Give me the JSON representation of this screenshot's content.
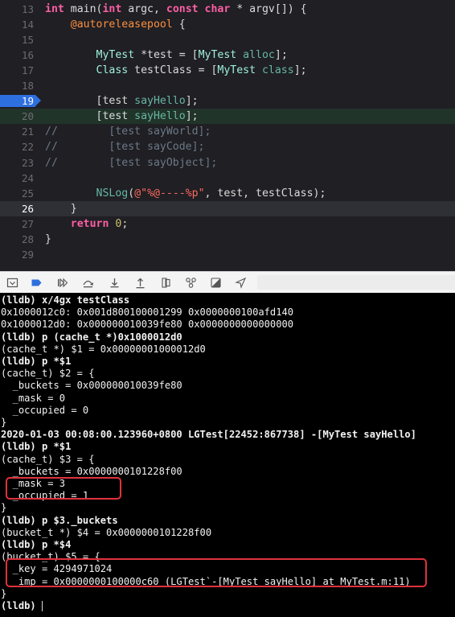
{
  "editor": {
    "lines": [
      {
        "num": "13",
        "tokens": [
          [
            "kw",
            "int"
          ],
          [
            "plain",
            " main("
          ],
          [
            "kw",
            "int"
          ],
          [
            "plain",
            " argc, "
          ],
          [
            "kw",
            "const"
          ],
          [
            "plain",
            " "
          ],
          [
            "kw",
            "char"
          ],
          [
            "plain",
            " * argv[]) {"
          ]
        ]
      },
      {
        "num": "14",
        "tokens": [
          [
            "plain",
            "    "
          ],
          [
            "macro",
            "@autoreleasepool"
          ],
          [
            "plain",
            " {"
          ]
        ]
      },
      {
        "num": "15",
        "tokens": []
      },
      {
        "num": "16",
        "tokens": [
          [
            "plain",
            "        "
          ],
          [
            "clsname",
            "MyTest"
          ],
          [
            "plain",
            " *test = ["
          ],
          [
            "clsname",
            "MyTest"
          ],
          [
            "plain",
            " "
          ],
          [
            "ex",
            "alloc"
          ],
          [
            "plain",
            "];"
          ]
        ]
      },
      {
        "num": "17",
        "tokens": [
          [
            "plain",
            "        "
          ],
          [
            "clsname",
            "Class"
          ],
          [
            "plain",
            " testClass = ["
          ],
          [
            "clsname",
            "MyTest"
          ],
          [
            "plain",
            " "
          ],
          [
            "ex",
            "class"
          ],
          [
            "plain",
            "];"
          ]
        ]
      },
      {
        "num": "18",
        "tokens": []
      },
      {
        "num": "19",
        "tokens": [
          [
            "plain",
            "        [test "
          ],
          [
            "fn",
            "sayHello"
          ],
          [
            "plain",
            "];"
          ]
        ]
      },
      {
        "num": "20",
        "tokens": [
          [
            "plain",
            "        [test "
          ],
          [
            "fn",
            "sayHello"
          ],
          [
            "plain",
            "];"
          ]
        ]
      },
      {
        "num": "21",
        "tokens": [
          [
            "cm",
            "//        [test sayWorld];"
          ]
        ]
      },
      {
        "num": "22",
        "tokens": [
          [
            "cm",
            "//        [test sayCode];"
          ]
        ]
      },
      {
        "num": "23",
        "tokens": [
          [
            "cm",
            "//        [test sayObject];"
          ]
        ]
      },
      {
        "num": "24",
        "tokens": []
      },
      {
        "num": "25",
        "tokens": [
          [
            "plain",
            "        "
          ],
          [
            "fn",
            "NSLog"
          ],
          [
            "plain",
            "("
          ],
          [
            "str",
            "@\"%@----%p\""
          ],
          [
            "plain",
            ", test, testClass);"
          ]
        ]
      },
      {
        "num": "26",
        "tokens": [
          [
            "plain",
            "    }"
          ]
        ]
      },
      {
        "num": "27",
        "tokens": [
          [
            "plain",
            "    "
          ],
          [
            "kw",
            "return"
          ],
          [
            "plain",
            " "
          ],
          [
            "num",
            "0"
          ],
          [
            "plain",
            ";"
          ]
        ]
      },
      {
        "num": "28",
        "tokens": [
          [
            "plain",
            "}"
          ]
        ]
      },
      {
        "num": "29",
        "tokens": []
      }
    ],
    "breakpoint_line": "19",
    "current_line": "26"
  },
  "debugbar": {
    "buttons": [
      {
        "name": "hide-debug-area-icon"
      },
      {
        "name": "breakpoints-toggle-icon"
      },
      {
        "name": "continue-icon"
      },
      {
        "name": "step-over-icon"
      },
      {
        "name": "step-into-icon"
      },
      {
        "name": "step-out-icon"
      },
      {
        "name": "view-hierarchy-icon"
      },
      {
        "name": "memory-graph-icon"
      },
      {
        "name": "environment-overrides-icon"
      },
      {
        "name": "simulate-location-icon"
      }
    ]
  },
  "console": {
    "lines": [
      {
        "text": "(lldb) x/4gx testClass",
        "cmd": true
      },
      {
        "text": "0x1000012c0: 0x001d800100001299 0x0000000100afd140",
        "cmd": false
      },
      {
        "text": "0x1000012d0: 0x000000010039fe80 0x0000000000000000",
        "cmd": false
      },
      {
        "text": "(lldb) p (cache_t *)0x1000012d0",
        "cmd": true
      },
      {
        "text": "(cache_t *) $1 = 0x00000001000012d0",
        "cmd": false
      },
      {
        "text": "(lldb) p *$1",
        "cmd": true
      },
      {
        "text": "(cache_t) $2 = {",
        "cmd": false
      },
      {
        "text": "  _buckets = 0x000000010039fe80",
        "cmd": false
      },
      {
        "text": "  _mask = 0",
        "cmd": false
      },
      {
        "text": "  _occupied = 0",
        "cmd": false
      },
      {
        "text": "}",
        "cmd": false
      },
      {
        "text": "2020-01-03 00:08:00.123960+0800 LGTest[22452:867738] -[MyTest sayHello]",
        "cmd": true
      },
      {
        "text": "(lldb) p *$1",
        "cmd": true
      },
      {
        "text": "(cache_t) $3 = {",
        "cmd": false
      },
      {
        "text": "  _buckets = 0x0000000101228f00",
        "cmd": false
      },
      {
        "text": "  _mask = 3",
        "cmd": false
      },
      {
        "text": "  _occupied = 1",
        "cmd": false
      },
      {
        "text": "}",
        "cmd": false
      },
      {
        "text": "(lldb) p $3._buckets",
        "cmd": true
      },
      {
        "text": "(bucket_t *) $4 = 0x0000000101228f00",
        "cmd": false
      },
      {
        "text": "(lldb) p *$4",
        "cmd": true
      },
      {
        "text": "(bucket_t) $5 = {",
        "cmd": false
      },
      {
        "text": "  _key = 4294971024",
        "cmd": false
      },
      {
        "text": "  _imp = 0x0000000100000c60 (LGTest`-[MyTest sayHello] at MyTest.m:11)",
        "cmd": false
      },
      {
        "text": "}",
        "cmd": false
      },
      {
        "text": "(lldb) ",
        "cmd": true
      }
    ]
  },
  "colors": {
    "editor_bg": "#1f1f24",
    "breakpoint": "#2e6fe0",
    "highlight_box": "#e0323b",
    "console_bg": "#000000"
  }
}
